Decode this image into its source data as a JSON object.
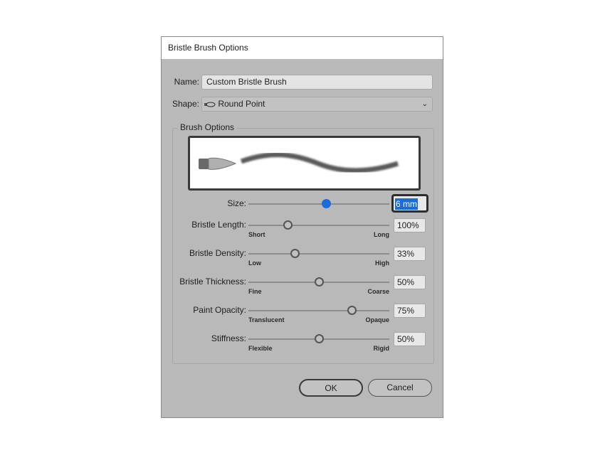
{
  "dialog": {
    "title": "Bristle Brush Options"
  },
  "name": {
    "label": "Name:",
    "value": "Custom Bristle Brush"
  },
  "shape": {
    "label": "Shape:",
    "value": "Round Point",
    "icon": "round-point-brush-icon"
  },
  "group_label": "Brush Options",
  "sliders": [
    {
      "label": "Size:",
      "value": "6 mm",
      "position_percent": 55,
      "min_label": "",
      "max_label": "",
      "focused": true
    },
    {
      "label": "Bristle Length:",
      "value": "100%",
      "position_percent": 28,
      "min_label": "Short",
      "max_label": "Long"
    },
    {
      "label": "Bristle Density:",
      "value": "33%",
      "position_percent": 33,
      "min_label": "Low",
      "max_label": "High"
    },
    {
      "label": "Bristle Thickness:",
      "value": "50%",
      "position_percent": 50,
      "min_label": "Fine",
      "max_label": "Coarse"
    },
    {
      "label": "Paint Opacity:",
      "value": "75%",
      "position_percent": 73,
      "min_label": "Translucent",
      "max_label": "Opaque"
    },
    {
      "label": "Stiffness:",
      "value": "50%",
      "position_percent": 50,
      "min_label": "Flexible",
      "max_label": "Rigid"
    }
  ],
  "buttons": {
    "ok": "OK",
    "cancel": "Cancel"
  },
  "colors": {
    "accent": "#1a6cd8",
    "background": "#b9b9b9"
  }
}
